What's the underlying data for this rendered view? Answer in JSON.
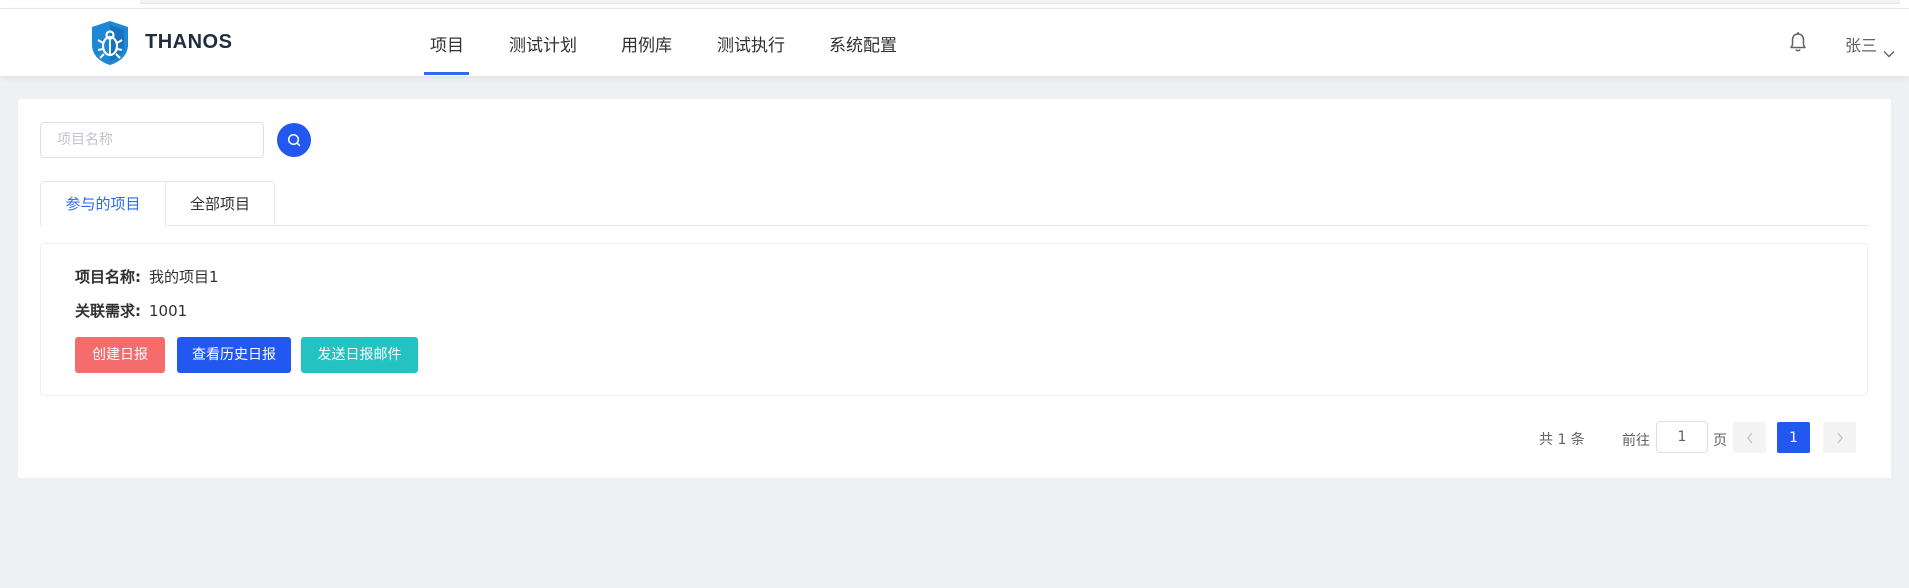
{
  "header": {
    "brand": "THANOS",
    "nav": [
      {
        "label": "项目",
        "active": true
      },
      {
        "label": "测试计划"
      },
      {
        "label": "用例库"
      },
      {
        "label": "测试执行"
      },
      {
        "label": "系统配置"
      }
    ],
    "user_name": "张三",
    "icons": {
      "logo": "bug-shield-logo",
      "bell": "bell-icon",
      "user_menu": "chevron-down-icon"
    }
  },
  "search": {
    "placeholder": "项目名称",
    "value": "",
    "icon": "search-icon"
  },
  "tabs": [
    {
      "label": "参与的项目",
      "active": true
    },
    {
      "label": "全部项目"
    }
  ],
  "project": {
    "name_label": "项目名称:",
    "name_value": "我的项目1",
    "req_label": "关联需求:",
    "req_value": "1001",
    "buttons": {
      "create": "创建日报",
      "history": "查看历史日报",
      "email": "发送日报邮件"
    }
  },
  "pagination": {
    "total": "共 1 条",
    "goto_prefix": "前往",
    "goto_value": "1",
    "goto_suffix": "页",
    "current_page": "1"
  },
  "colors": {
    "accent": "#2258f0",
    "danger": "#f56c6c",
    "teal": "#25c2c2",
    "logo": "#1e88d6",
    "background": "#eff0f3"
  }
}
